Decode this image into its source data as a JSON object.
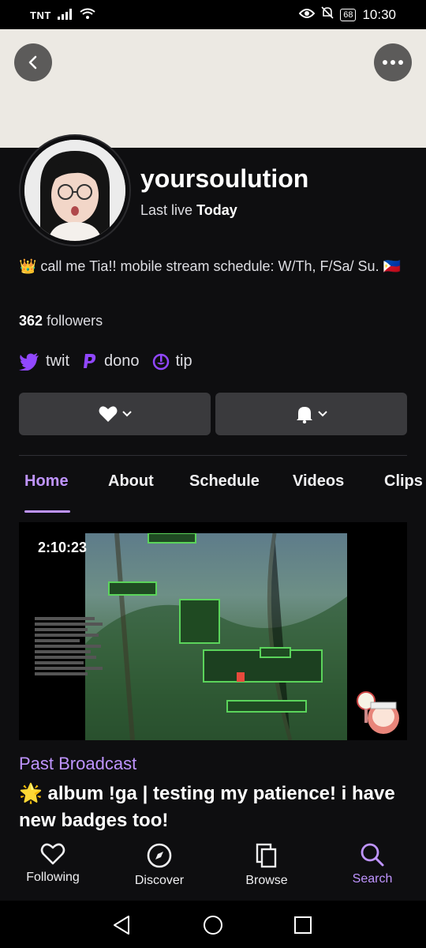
{
  "status_bar": {
    "carrier": "TNT",
    "battery": "68",
    "time": "10:30"
  },
  "profile": {
    "username": "yoursoulution",
    "last_live_prefix": "Last live",
    "last_live_value": "Today",
    "bio": "👑 call me Tia!! mobile stream schedule: W/Th, F/Sa/ Su. 🇵🇭",
    "followers_count": "362",
    "followers_label": "followers"
  },
  "links": [
    {
      "label": "twit",
      "icon": "twitter-icon"
    },
    {
      "label": "dono",
      "icon": "paypal-icon"
    },
    {
      "label": "tip",
      "icon": "streamelements-icon"
    }
  ],
  "tabs": [
    {
      "label": "Home",
      "active": true
    },
    {
      "label": "About"
    },
    {
      "label": "Schedule"
    },
    {
      "label": "Videos"
    },
    {
      "label": "Clips"
    }
  ],
  "video": {
    "duration": "2:10:23",
    "type_label": "Past Broadcast",
    "title": "🌟 album !ga | testing my patience! i have new badges too!"
  },
  "bottom_nav": [
    {
      "label": "Following",
      "icon": "heart-icon"
    },
    {
      "label": "Discover",
      "icon": "compass-icon"
    },
    {
      "label": "Browse",
      "icon": "browse-icon"
    },
    {
      "label": "Search",
      "icon": "search-icon",
      "active": true
    }
  ],
  "colors": {
    "accent": "#bf94ff",
    "background": "#0e0e10",
    "banner": "#ece9e3",
    "button": "#3a3a3d"
  }
}
